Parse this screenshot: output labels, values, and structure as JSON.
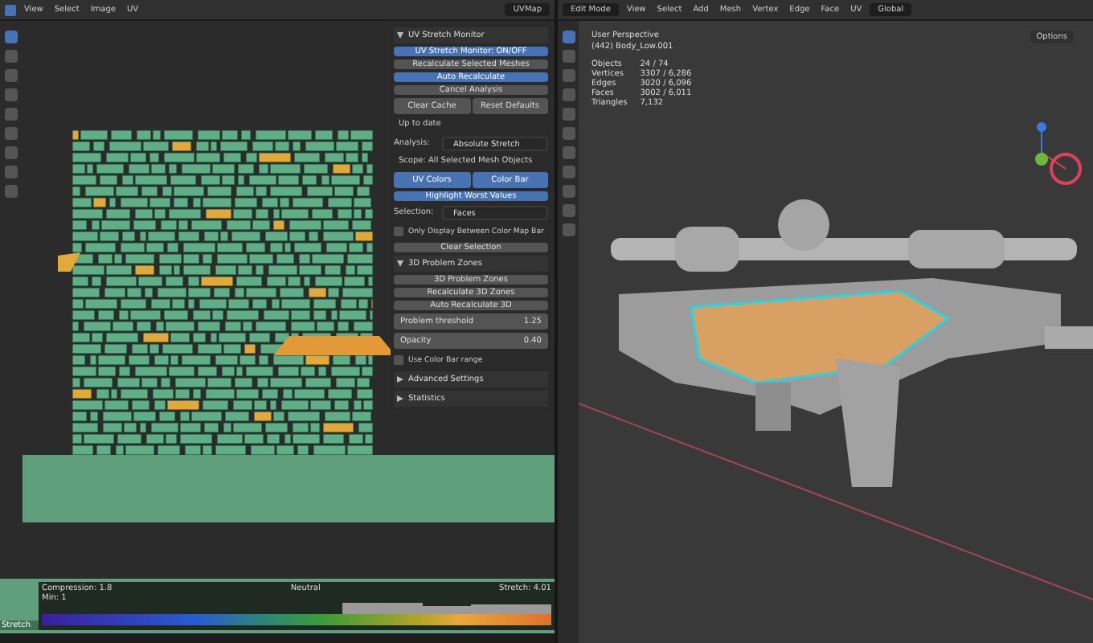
{
  "uv_editor": {
    "menus": [
      "View",
      "Select",
      "Image",
      "UV"
    ],
    "uv_map": "UVMap"
  },
  "panel": {
    "rows": [
      {
        "kind": "section",
        "label": "UV Stretch Monitor",
        "expanded": true
      },
      {
        "kind": "button",
        "label": "UV Stretch Monitor: ON/OFF",
        "selected": true
      },
      {
        "kind": "button",
        "label": "Recalculate Selected Meshes",
        "selected": false
      },
      {
        "kind": "button",
        "label": "Auto Recalculate",
        "selected": true
      },
      {
        "kind": "button",
        "label": "Cancel Analysis",
        "selected": false
      },
      {
        "kind": "pair",
        "items": [
          {
            "label": "Clear Cache",
            "selected": false
          },
          {
            "label": "Reset Defaults",
            "selected": false
          }
        ]
      },
      {
        "kind": "status",
        "label": "Up to date"
      },
      {
        "kind": "dropdown",
        "label": "Analysis:",
        "value": "Absolute Stretch"
      },
      {
        "kind": "status",
        "label": "Scope: All Selected Mesh Objects"
      },
      {
        "kind": "pair",
        "items": [
          {
            "label": "UV Colors",
            "selected": true
          },
          {
            "label": "Color Bar",
            "selected": true
          }
        ]
      },
      {
        "kind": "button",
        "label": "Highlight Worst Values",
        "selected": true
      },
      {
        "kind": "dropdown",
        "label": "Selection:",
        "value": "Faces"
      },
      {
        "kind": "checkbox",
        "label": "Only Display Between Color Map Bar",
        "checked": false
      },
      {
        "kind": "button",
        "label": "Clear Selection",
        "selected": false
      },
      {
        "kind": "section",
        "label": "3D Problem Zones",
        "expanded": true
      },
      {
        "kind": "button",
        "label": "3D Problem Zones",
        "selected": false
      },
      {
        "kind": "button",
        "label": "Recalculate 3D Zones",
        "selected": false
      },
      {
        "kind": "button",
        "label": "Auto Recalculate 3D",
        "selected": false
      },
      {
        "kind": "value",
        "label": "Problem threshold",
        "value": "1.25"
      },
      {
        "kind": "value",
        "label": "Opacity",
        "value": "0.40"
      },
      {
        "kind": "checkbox",
        "label": "Use Color Bar range",
        "checked": false
      },
      {
        "kind": "section",
        "label": "Advanced Settings",
        "expanded": false
      },
      {
        "kind": "section",
        "label": "Statistics",
        "expanded": false
      }
    ]
  },
  "color_bar": {
    "compression": "Compression: 1.8",
    "min": "Min: 1",
    "neutral": "Neutral",
    "stretch": "Stretch: 4.01",
    "side_label": "Stretch"
  },
  "viewport": {
    "mode": "Edit Mode",
    "menus": [
      "View",
      "Select",
      "Add",
      "Mesh",
      "Vertex",
      "Edge",
      "Face",
      "UV"
    ],
    "orientation": "Global",
    "options": "Options",
    "perspective": "User Perspective",
    "object": "(442) Body_Low.001",
    "stats": [
      {
        "label": "Objects",
        "value": "24 / 74"
      },
      {
        "label": "Vertices",
        "value": "3307 / 6,286"
      },
      {
        "label": "Edges",
        "value": "3020 / 6,096"
      },
      {
        "label": "Faces",
        "value": "3002 / 6,011"
      },
      {
        "label": "Triangles",
        "value": "7,132"
      }
    ]
  }
}
